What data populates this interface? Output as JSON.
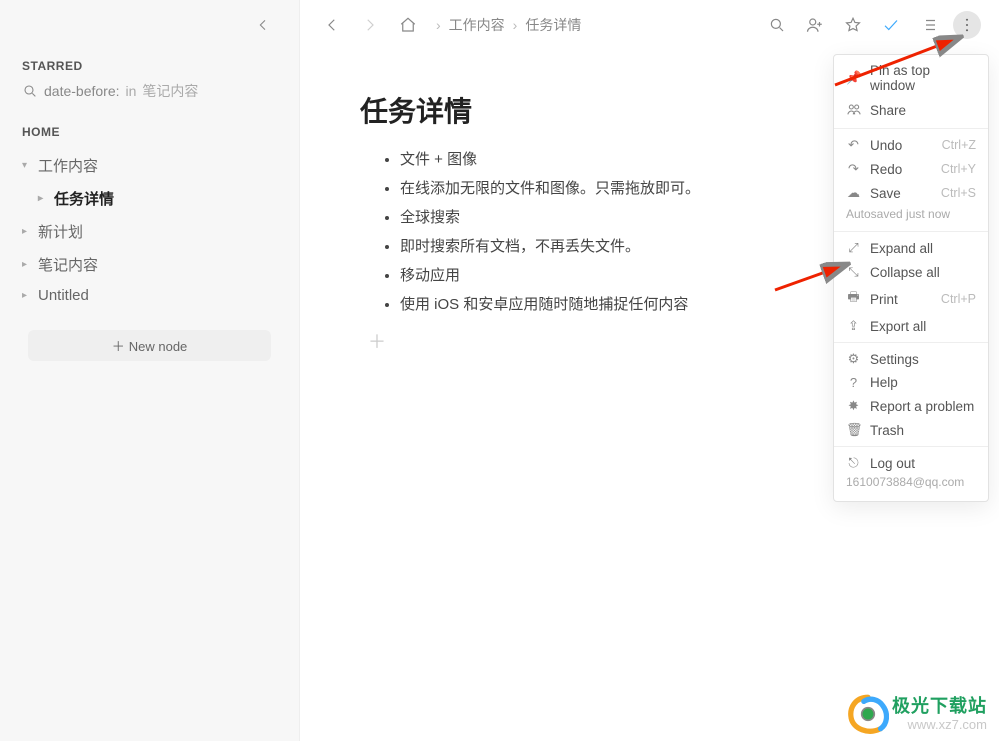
{
  "sidebar": {
    "starred_label": "STARRED",
    "search_query": "date-before:",
    "search_in_prefix": "in",
    "search_in_target": "笔记内容",
    "home_label": "HOME",
    "items": [
      {
        "label": "工作内容",
        "depth": 0,
        "expanded": true,
        "active": false
      },
      {
        "label": "任务详情",
        "depth": 1,
        "expanded": false,
        "active": true
      },
      {
        "label": "新计划",
        "depth": 0,
        "expanded": false,
        "active": false
      },
      {
        "label": "笔记内容",
        "depth": 0,
        "expanded": false,
        "active": false
      },
      {
        "label": "Untitled",
        "depth": 0,
        "expanded": false,
        "active": false
      }
    ],
    "new_node_label": "New node"
  },
  "breadcrumbs": [
    "工作内容",
    "任务详情"
  ],
  "document": {
    "title": "任务详情",
    "bullets": [
      "文件 + 图像",
      "在线添加无限的文件和图像。只需拖放即可。",
      "全球搜索",
      "即时搜索所有文档，不再丢失文件。",
      "移动应用",
      "使用 iOS 和安卓应用随时随地捕捉任何内容"
    ]
  },
  "menu": {
    "pin": "Pin as top window",
    "share": "Share",
    "undo": "Undo",
    "undo_sc": "Ctrl+Z",
    "redo": "Redo",
    "redo_sc": "Ctrl+Y",
    "save": "Save",
    "save_sc": "Ctrl+S",
    "autosaved": "Autosaved just now",
    "expand": "Expand all",
    "collapse": "Collapse all",
    "print": "Print",
    "print_sc": "Ctrl+P",
    "export": "Export all",
    "settings": "Settings",
    "help": "Help",
    "report": "Report a problem",
    "trash": "Trash",
    "logout": "Log out",
    "user_email": "1610073884@qq.com"
  },
  "watermark": {
    "line1": "极光下载站",
    "line2": "www.xz7.com"
  }
}
